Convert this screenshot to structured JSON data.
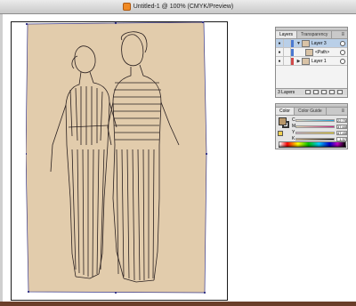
{
  "window": {
    "title": "Untitled-1 @ 100% (CMYK/Preview)",
    "doc_icon": "illustrator-doc-icon"
  },
  "layers_panel": {
    "tabs": [
      "Layers",
      "Transparency"
    ],
    "active_tab": "Layers",
    "rows": [
      {
        "name": "Layer 3",
        "selected": true,
        "visible": true,
        "color": "#4a78d0"
      },
      {
        "name": "<Path>",
        "selected": false,
        "visible": true,
        "indent": true,
        "color": "#4a78d0"
      },
      {
        "name": "Layer 1",
        "selected": false,
        "visible": true,
        "color": "#d04a4a"
      }
    ],
    "footer_label": "3 Layers"
  },
  "color_panel": {
    "tabs": [
      "Color",
      "Color Guide"
    ],
    "active_tab": "Color",
    "fill_color": "#b8976a",
    "channels": [
      {
        "label": "C",
        "value": "22.75"
      },
      {
        "label": "M",
        "value": "37.65"
      },
      {
        "label": "Y",
        "value": "47.45"
      },
      {
        "label": "K",
        "value": "1.57"
      }
    ]
  }
}
